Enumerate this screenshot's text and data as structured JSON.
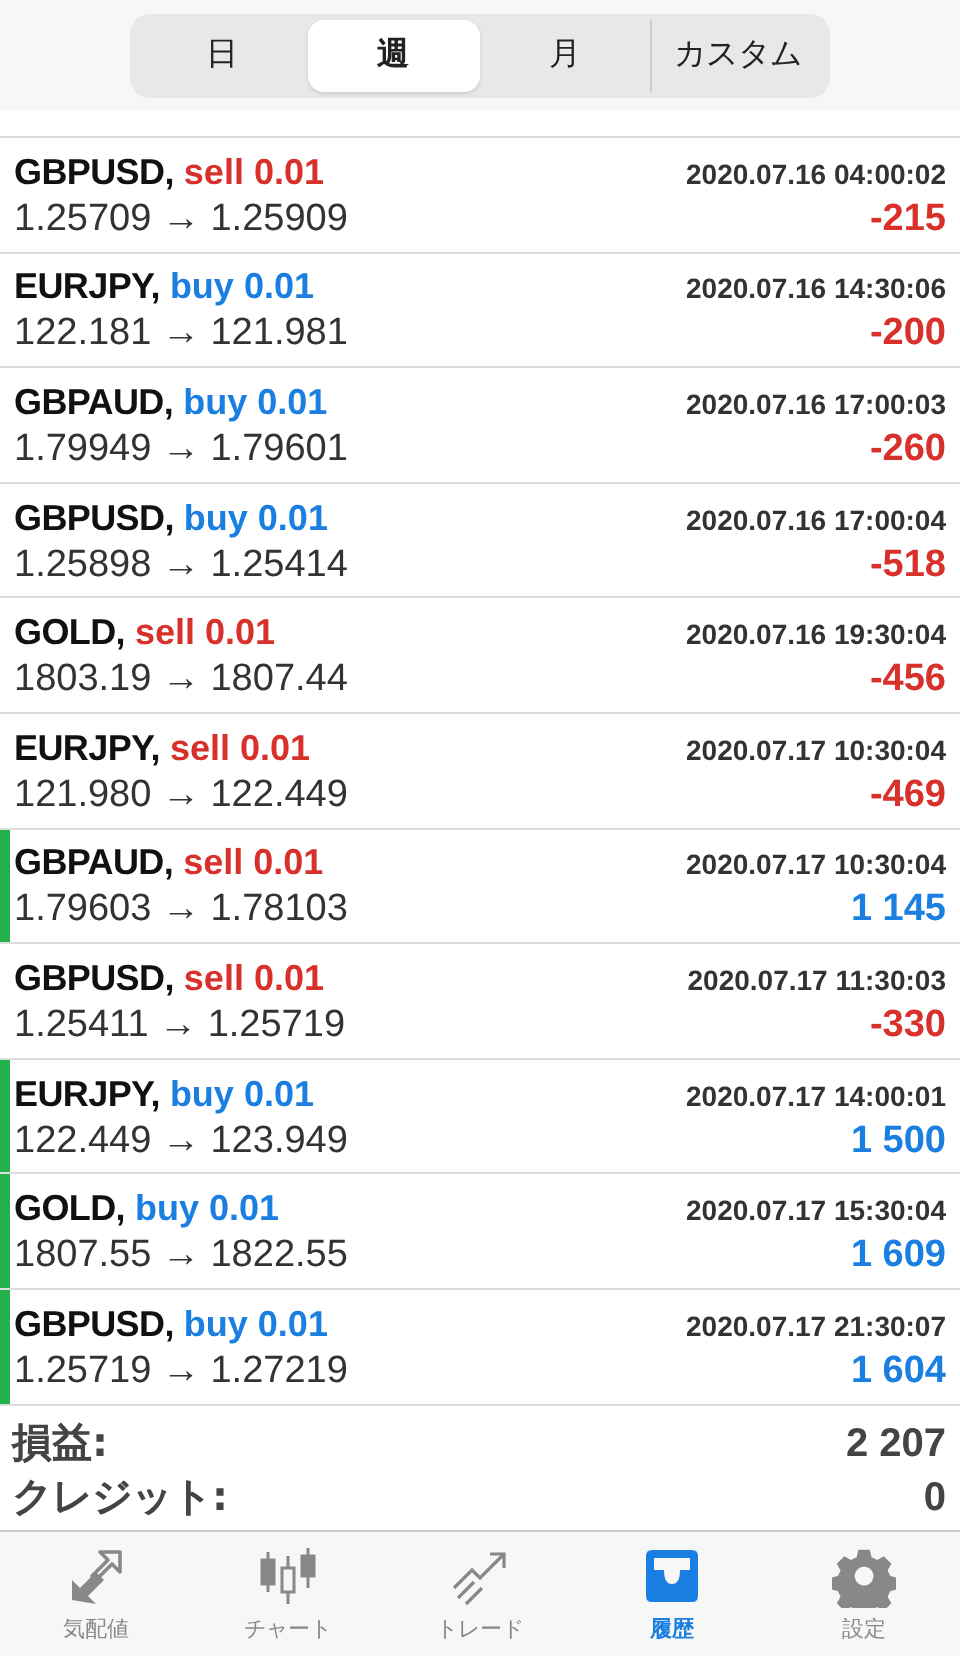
{
  "periods": [
    {
      "label": "日",
      "selected": false
    },
    {
      "label": "週",
      "selected": true
    },
    {
      "label": "月",
      "selected": false
    },
    {
      "label": "カスタム",
      "selected": false
    }
  ],
  "trades": [
    {
      "symbol": "GBPUSD,",
      "kind": "sell",
      "action": "sell 0.01",
      "time": "2020.07.16 04:00:02",
      "prices": "1.25709 → 1.25909",
      "profit": "-215",
      "profitable": false
    },
    {
      "symbol": "EURJPY,",
      "kind": "buy",
      "action": "buy 0.01",
      "time": "2020.07.16 14:30:06",
      "prices": "122.181 → 121.981",
      "profit": "-200",
      "profitable": false
    },
    {
      "symbol": "GBPAUD,",
      "kind": "buy",
      "action": "buy 0.01",
      "time": "2020.07.16 17:00:03",
      "prices": "1.79949 → 1.79601",
      "profit": "-260",
      "profitable": false
    },
    {
      "symbol": "GBPUSD,",
      "kind": "buy",
      "action": "buy 0.01",
      "time": "2020.07.16 17:00:04",
      "prices": "1.25898 → 1.25414",
      "profit": "-518",
      "profitable": false
    },
    {
      "symbol": "GOLD,",
      "kind": "sell",
      "action": "sell 0.01",
      "time": "2020.07.16 19:30:04",
      "prices": "1803.19 → 1807.44",
      "profit": "-456",
      "profitable": false
    },
    {
      "symbol": "EURJPY,",
      "kind": "sell",
      "action": "sell 0.01",
      "time": "2020.07.17 10:30:04",
      "prices": "121.980 → 122.449",
      "profit": "-469",
      "profitable": false
    },
    {
      "symbol": "GBPAUD,",
      "kind": "sell",
      "action": "sell 0.01",
      "time": "2020.07.17 10:30:04",
      "prices": "1.79603 → 1.78103",
      "profit": "1 145",
      "profitable": true
    },
    {
      "symbol": "GBPUSD,",
      "kind": "sell",
      "action": "sell 0.01",
      "time": "2020.07.17 11:30:03",
      "prices": "1.25411 → 1.25719",
      "profit": "-330",
      "profitable": false
    },
    {
      "symbol": "EURJPY,",
      "kind": "buy",
      "action": "buy 0.01",
      "time": "2020.07.17 14:00:01",
      "prices": "122.449 → 123.949",
      "profit": "1 500",
      "profitable": true
    },
    {
      "symbol": "GOLD,",
      "kind": "buy",
      "action": "buy 0.01",
      "time": "2020.07.17 15:30:04",
      "prices": "1807.55 → 1822.55",
      "profit": "1 609",
      "profitable": true
    },
    {
      "symbol": "GBPUSD,",
      "kind": "buy",
      "action": "buy 0.01",
      "time": "2020.07.17 21:30:07",
      "prices": "1.25719 → 1.27219",
      "profit": "1 604",
      "profitable": true
    }
  ],
  "summary": [
    {
      "label": "損益:",
      "value": "2 207"
    },
    {
      "label": "クレジット:",
      "value": "0"
    }
  ],
  "tabs": [
    {
      "kind": "quotes",
      "label": "気配値",
      "selected": false
    },
    {
      "kind": "chart",
      "label": "チャート",
      "selected": false
    },
    {
      "kind": "trade",
      "label": "トレード",
      "selected": false
    },
    {
      "kind": "history",
      "label": "履歴",
      "selected": true
    },
    {
      "kind": "settings",
      "label": "設定",
      "selected": false
    }
  ]
}
